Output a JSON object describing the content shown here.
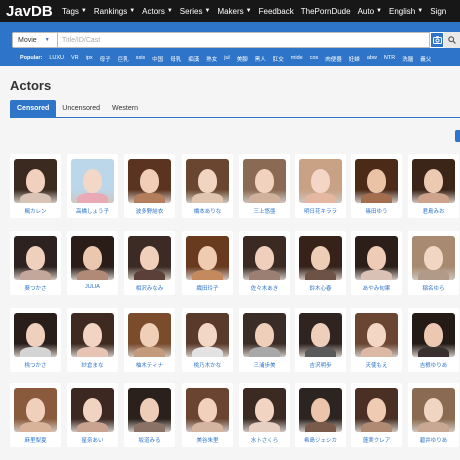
{
  "logo": "JavDB",
  "nav": [
    {
      "label": "Tags",
      "caret": true
    },
    {
      "label": "Rankings",
      "caret": true
    },
    {
      "label": "Actors",
      "caret": true
    },
    {
      "label": "Series",
      "caret": true
    },
    {
      "label": "Makers",
      "caret": true
    },
    {
      "label": "Feedback",
      "caret": false
    },
    {
      "label": "ThePornDude",
      "caret": false
    },
    {
      "label": "Auto",
      "caret": true
    },
    {
      "label": "English",
      "caret": true
    },
    {
      "label": "Sign",
      "caret": false
    }
  ],
  "search": {
    "type_label": "Movie",
    "placeholder": "Title/ID/Cast"
  },
  "popular": {
    "label": "Popular:",
    "tags": [
      "LUXU",
      "VR",
      "ipx",
      "母子",
      "巨乳",
      "ssis",
      "中国",
      "母乳",
      "痴漢",
      "熟女",
      "jul",
      "美腳",
      "黑人",
      "肛交",
      "mide",
      "cos",
      "肉便器",
      "妊婦",
      "abw",
      "NTR",
      "洗腦",
      "義父"
    ]
  },
  "page_title": "Actors",
  "tabs": [
    {
      "label": "Censored",
      "active": true
    },
    {
      "label": "Uncensored",
      "active": false
    },
    {
      "label": "Western",
      "active": false
    }
  ],
  "actors": [
    {
      "name": "楓カレン",
      "hair": "#3a2a20",
      "skin": "#f1d1bd",
      "body": "#d8c3b5"
    },
    {
      "name": "高橋しょう子",
      "hair": "#bcd6ea",
      "skin": "#f3d8c8",
      "body": "#e9a9b5"
    },
    {
      "name": "波多野結衣",
      "hair": "#5a3420",
      "skin": "#efcdb7",
      "body": "#b47d5b"
    },
    {
      "name": "橋本ありな",
      "hair": "#6a4630",
      "skin": "#f2d4c2",
      "body": "#e0c5b0"
    },
    {
      "name": "三上悠亜",
      "hair": "#8a6a52",
      "skin": "#f1d2bf",
      "body": "#d0b19c"
    },
    {
      "name": "明日花キララ",
      "hair": "#c9a184",
      "skin": "#f4d6c6",
      "body": "#e5b7a1"
    },
    {
      "name": "篠田ゆう",
      "hair": "#4b2a18",
      "skin": "#eac2a6",
      "body": "#a46e4e"
    },
    {
      "name": "君島みお",
      "hair": "#3b2418",
      "skin": "#ecc9b1",
      "body": "#cda48b"
    },
    {
      "name": "葵つかさ",
      "hair": "#2e2220",
      "skin": "#efd0bc",
      "body": "#c3a79a"
    },
    {
      "name": "JULIA",
      "hair": "#2a1c16",
      "skin": "#ebc7b0",
      "body": "#b08a77"
    },
    {
      "name": "相沢みなみ",
      "hair": "#3c2a24",
      "skin": "#f0cfbb",
      "body": "#5a4038"
    },
    {
      "name": "織田玲子",
      "hair": "#6a3a1e",
      "skin": "#efcbb1",
      "body": "#c48a5e"
    },
    {
      "name": "佐々木あき",
      "hair": "#3a2a22",
      "skin": "#f0d0bc",
      "body": "#9b7f72"
    },
    {
      "name": "鈴木心春",
      "hair": "#362218",
      "skin": "#eecdb6",
      "body": "#6d5246"
    },
    {
      "name": "あやみ旬果",
      "hair": "#2c1e18",
      "skin": "#edcbb5",
      "body": "#d9c2b5"
    },
    {
      "name": "稲名ゆら",
      "hair": "#a88a70",
      "skin": "#f1d6c4",
      "body": "#b19a88"
    },
    {
      "name": "桃つかさ",
      "hair": "#2a1e1a",
      "skin": "#eed0bd",
      "body": "#d4d4d4"
    },
    {
      "name": "紗倉まな",
      "hair": "#3e2a20",
      "skin": "#f2d4c2",
      "body": "#e8c4b4"
    },
    {
      "name": "柚木ティナ",
      "hair": "#7a4c2c",
      "skin": "#efcfb8",
      "body": "#c49a7c"
    },
    {
      "name": "桃乃木かな",
      "hair": "#5a3a2a",
      "skin": "#f2d6c6",
      "body": "#e3e3e3"
    },
    {
      "name": "三浦歩美",
      "hair": "#3a2c26",
      "skin": "#efcfba",
      "body": "#a8a8a8"
    },
    {
      "name": "吉沢明歩",
      "hair": "#2f2420",
      "skin": "#eecfbc",
      "body": "#5a5a5a"
    },
    {
      "name": "天使もえ",
      "hair": "#6a4632",
      "skin": "#f3d6c4",
      "body": "#ddb8a4"
    },
    {
      "name": "吉根ゆりあ",
      "hair": "#241a16",
      "skin": "#ecc8b2",
      "body": "#3a3030"
    },
    {
      "name": "麻里梨夏",
      "hair": "#8a5a3c",
      "skin": "#f0d0bb",
      "body": "#d9b29a"
    },
    {
      "name": "星奈あい",
      "hair": "#3c2820",
      "skin": "#f1d3c1",
      "body": "#c9a390"
    },
    {
      "name": "坂道みる",
      "hair": "#2a201c",
      "skin": "#eecdb8",
      "body": "#8a7266"
    },
    {
      "name": "美谷朱里",
      "hair": "#6a4430",
      "skin": "#f1d1bd",
      "body": "#d4b5a2"
    },
    {
      "name": "水卜さくら",
      "hair": "#3a2a22",
      "skin": "#f2d4c3",
      "body": "#e4cfc2"
    },
    {
      "name": "希島ジェシカ",
      "hair": "#2c2420",
      "skin": "#ebc4ab",
      "body": "#7a5a4a"
    },
    {
      "name": "蓮実クレア",
      "hair": "#4a3024",
      "skin": "#eecbb2",
      "body": "#b08a72"
    },
    {
      "name": "碧井ゆりあ",
      "hair": "#8a6a50",
      "skin": "#f1d5c3",
      "body": "#c8a892"
    }
  ]
}
